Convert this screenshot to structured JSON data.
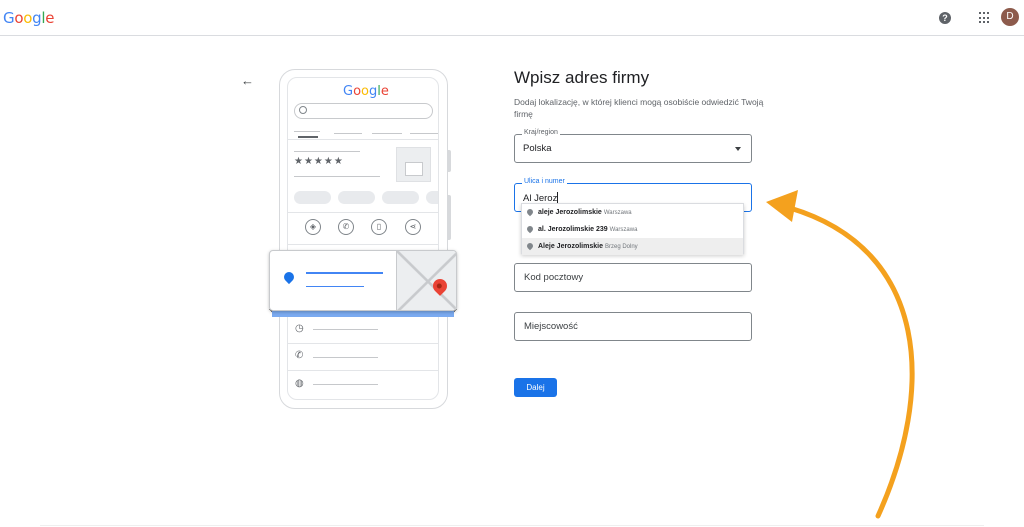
{
  "header": {
    "logo_letters": [
      {
        "char": "G",
        "color": "#4285F4"
      },
      {
        "char": "o",
        "color": "#EA4335"
      },
      {
        "char": "o",
        "color": "#FBBC05"
      },
      {
        "char": "g",
        "color": "#4285F4"
      },
      {
        "char": "l",
        "color": "#34A853"
      },
      {
        "char": "e",
        "color": "#EA4335"
      }
    ],
    "help_icon_glyph": "?",
    "avatar_initial": "D"
  },
  "illustration": {
    "stars": "★★★★★",
    "phone_logo_letters": [
      {
        "char": "G",
        "color": "#4285F4"
      },
      {
        "char": "o",
        "color": "#EA4335"
      },
      {
        "char": "o",
        "color": "#FBBC05"
      },
      {
        "char": "g",
        "color": "#4285F4"
      },
      {
        "char": "l",
        "color": "#34A853"
      },
      {
        "char": "e",
        "color": "#EA4335"
      }
    ]
  },
  "form": {
    "title": "Wpisz adres firmy",
    "subtitle": "Dodaj lokalizację, w której klienci mogą osobiście odwiedzić Twoją firmę",
    "country": {
      "label": "Kraj/region",
      "value": "Polska"
    },
    "street": {
      "label": "Ulica i numer",
      "value": "Al Jeroz"
    },
    "suggestions": [
      {
        "main": "aleje Jerozolimskie",
        "city": "Warszawa"
      },
      {
        "main": "al. Jerozolimskie 239",
        "city": "Warszawa"
      },
      {
        "main": "Aleje Jerozolimskie",
        "city": "Brzeg Dolny"
      }
    ],
    "postal_code": {
      "placeholder": "Kod pocztowy"
    },
    "city": {
      "placeholder": "Miejscowość"
    },
    "next_label": "Dalej"
  },
  "colors": {
    "accent": "#1a73e8",
    "annotation_arrow": "#F4A11E"
  }
}
